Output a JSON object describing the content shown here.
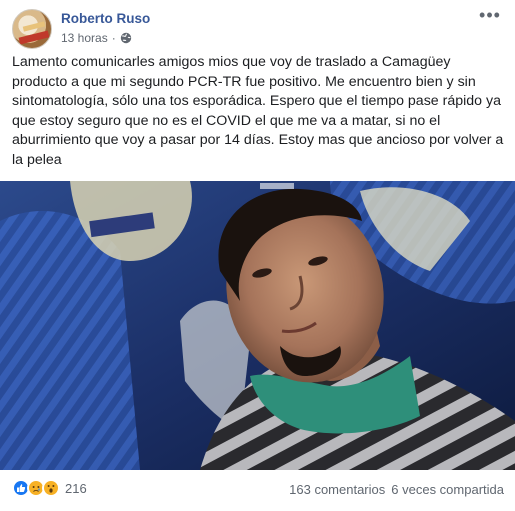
{
  "post": {
    "author": "Roberto Ruso",
    "time": "13 hours",
    "time_label": "13 horas",
    "separator": "·",
    "privacy_icon": "globe-icon",
    "more_icon": "more-options-icon",
    "more_glyph": "•••",
    "text": "Lamento comunicarles amigos mios que voy de traslado a Camagüey producto a que mi segundo PCR-TR fue positivo. Me encuentro bien y sin sintomatología, sólo una tos esporádica. Espero que el tiempo pase rápido ya que estoy seguro que no es el COVID el que me va a matar, si no el aburrimiento que voy a pasar por 14 días. Estoy mas que ancioso por volver a la pelea",
    "image_icon": "post-photo"
  },
  "footer": {
    "reactions": [
      {
        "name": "like-reaction-icon",
        "color": "#1877f2"
      },
      {
        "name": "sad-reaction-icon",
        "color": "#f7b125"
      },
      {
        "name": "wow-reaction-icon",
        "color": "#f7b125"
      }
    ],
    "reaction_count": "216",
    "comments": "163 comentarios",
    "shares": "6 veces compartida"
  },
  "colors": {
    "author_link": "#385898",
    "meta_text": "#606770",
    "body_text": "#1c1e21"
  }
}
